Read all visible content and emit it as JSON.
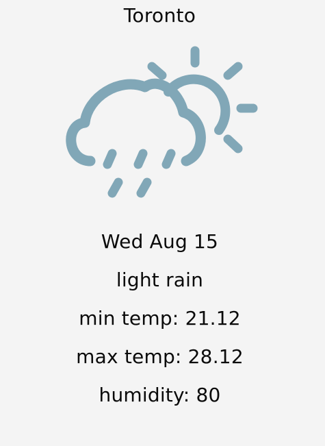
{
  "weather": {
    "city": "Toronto",
    "icon": "cloud-sun-rain-icon",
    "icon_color": "#81a7b7",
    "date": "Wed Aug 15",
    "description": "light rain",
    "min_temp_label": "min temp:",
    "min_temp": "21.12",
    "max_temp_label": "max temp:",
    "max_temp": "28.12",
    "humidity_label": "humidity:",
    "humidity": "80"
  }
}
